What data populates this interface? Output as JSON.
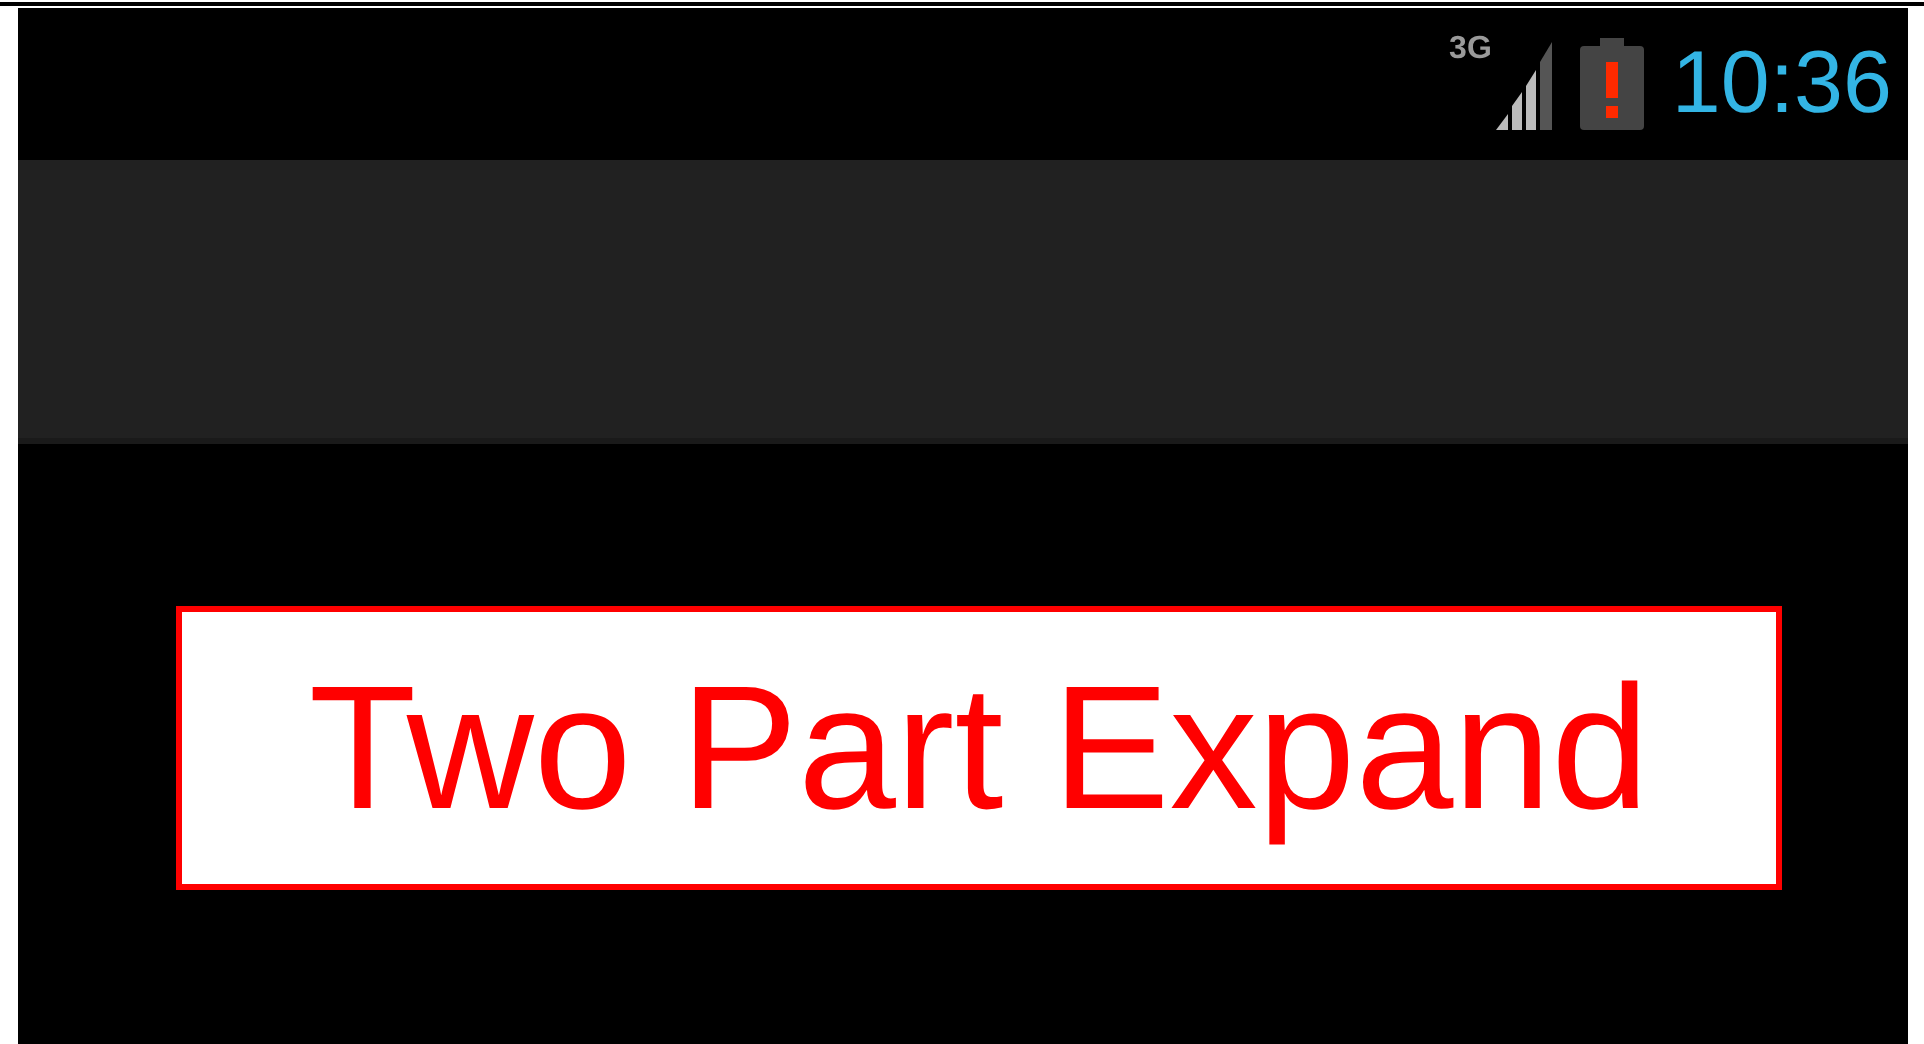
{
  "status_bar": {
    "network": "3G",
    "time": "10:36",
    "battery_alert": true
  },
  "button": {
    "label": "Two Part Expand"
  }
}
